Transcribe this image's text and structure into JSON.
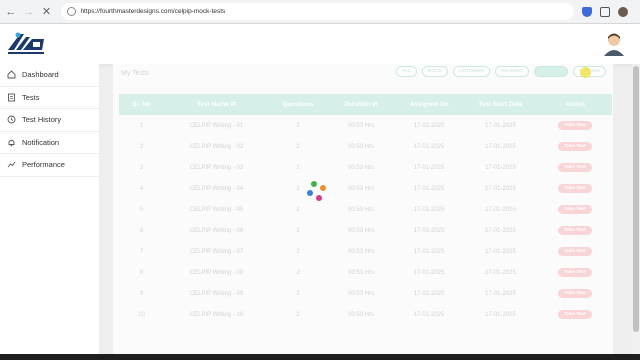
{
  "browser": {
    "url": "https://fourthmasterdesigns.com/celpip-mock-tests",
    "icons": [
      "back-arrow-icon",
      "forward-arrow-icon",
      "reload-icon",
      "site-info-icon",
      "shield-extension-icon",
      "puzzle-extension-icon",
      "profile-icon",
      "menu-icon"
    ]
  },
  "sidebar": {
    "items": [
      {
        "label": "Dashboard",
        "icon": "home-icon"
      },
      {
        "label": "Tests",
        "icon": "document-icon"
      },
      {
        "label": "Test History",
        "icon": "history-icon"
      },
      {
        "label": "Notification",
        "icon": "bell-icon"
      },
      {
        "label": "Performance",
        "icon": "chart-icon"
      }
    ]
  },
  "main": {
    "title": "My Tests",
    "filters": [
      "ALL",
      "MOCK",
      "LISTENING",
      "READING",
      "",
      "WRITING"
    ],
    "columns": [
      "Sr. No",
      "Test Name ⇄",
      "Questions",
      "Duration ⇄",
      "Assigned On",
      "Test Start Date",
      "Action"
    ],
    "rows": [
      {
        "sr": "1",
        "name": "CELPIP Writing - 01",
        "questions": "2",
        "duration": "00:53 Hrs",
        "assigned": "17-01-2025",
        "start": "17-01-2025",
        "action": "Take Test"
      },
      {
        "sr": "2",
        "name": "CELPIP Writing - 02",
        "questions": "2",
        "duration": "00:53 Hrs",
        "assigned": "17-01-2025",
        "start": "17-01-2025",
        "action": "Take Test"
      },
      {
        "sr": "3",
        "name": "CELPIP Writing - 03",
        "questions": "2",
        "duration": "00:53 Hrs",
        "assigned": "17-01-2025",
        "start": "17-01-2025",
        "action": "Take Test"
      },
      {
        "sr": "4",
        "name": "CELPIP Writing - 04",
        "questions": "2",
        "duration": "00:53 Hrs",
        "assigned": "17-01-2025",
        "start": "17-01-2025",
        "action": "Take Test"
      },
      {
        "sr": "5",
        "name": "CELPIP Writing - 05",
        "questions": "2",
        "duration": "00:53 Hrs",
        "assigned": "17-01-2025",
        "start": "17-01-2025",
        "action": "Take Test"
      },
      {
        "sr": "6",
        "name": "CELPIP Writing - 06",
        "questions": "2",
        "duration": "00:53 Hrs",
        "assigned": "17-01-2025",
        "start": "17-01-2025",
        "action": "Take Test"
      },
      {
        "sr": "7",
        "name": "CELPIP Writing - 07",
        "questions": "2",
        "duration": "00:53 Hrs",
        "assigned": "17-01-2025",
        "start": "17-01-2025",
        "action": "Take Test"
      },
      {
        "sr": "8",
        "name": "CELPIP Writing - 08",
        "questions": "2",
        "duration": "00:53 Hrs",
        "assigned": "17-01-2025",
        "start": "17-01-2025",
        "action": "Take Test"
      },
      {
        "sr": "9",
        "name": "CELPIP Writing - 09",
        "questions": "2",
        "duration": "00:53 Hrs",
        "assigned": "17-01-2025",
        "start": "17-01-2025",
        "action": "Take Test"
      },
      {
        "sr": "10",
        "name": "CELPIP Writing - 10",
        "questions": "2",
        "duration": "00:53 Hrs",
        "assigned": "17-01-2025",
        "start": "17-01-2025",
        "action": "Take Test"
      }
    ]
  },
  "colors": {
    "header_bg": "#a6dccf",
    "take_test": "#f4a2a6",
    "filter_border": "#8ccfbd",
    "logo": "#1b3a6b"
  }
}
